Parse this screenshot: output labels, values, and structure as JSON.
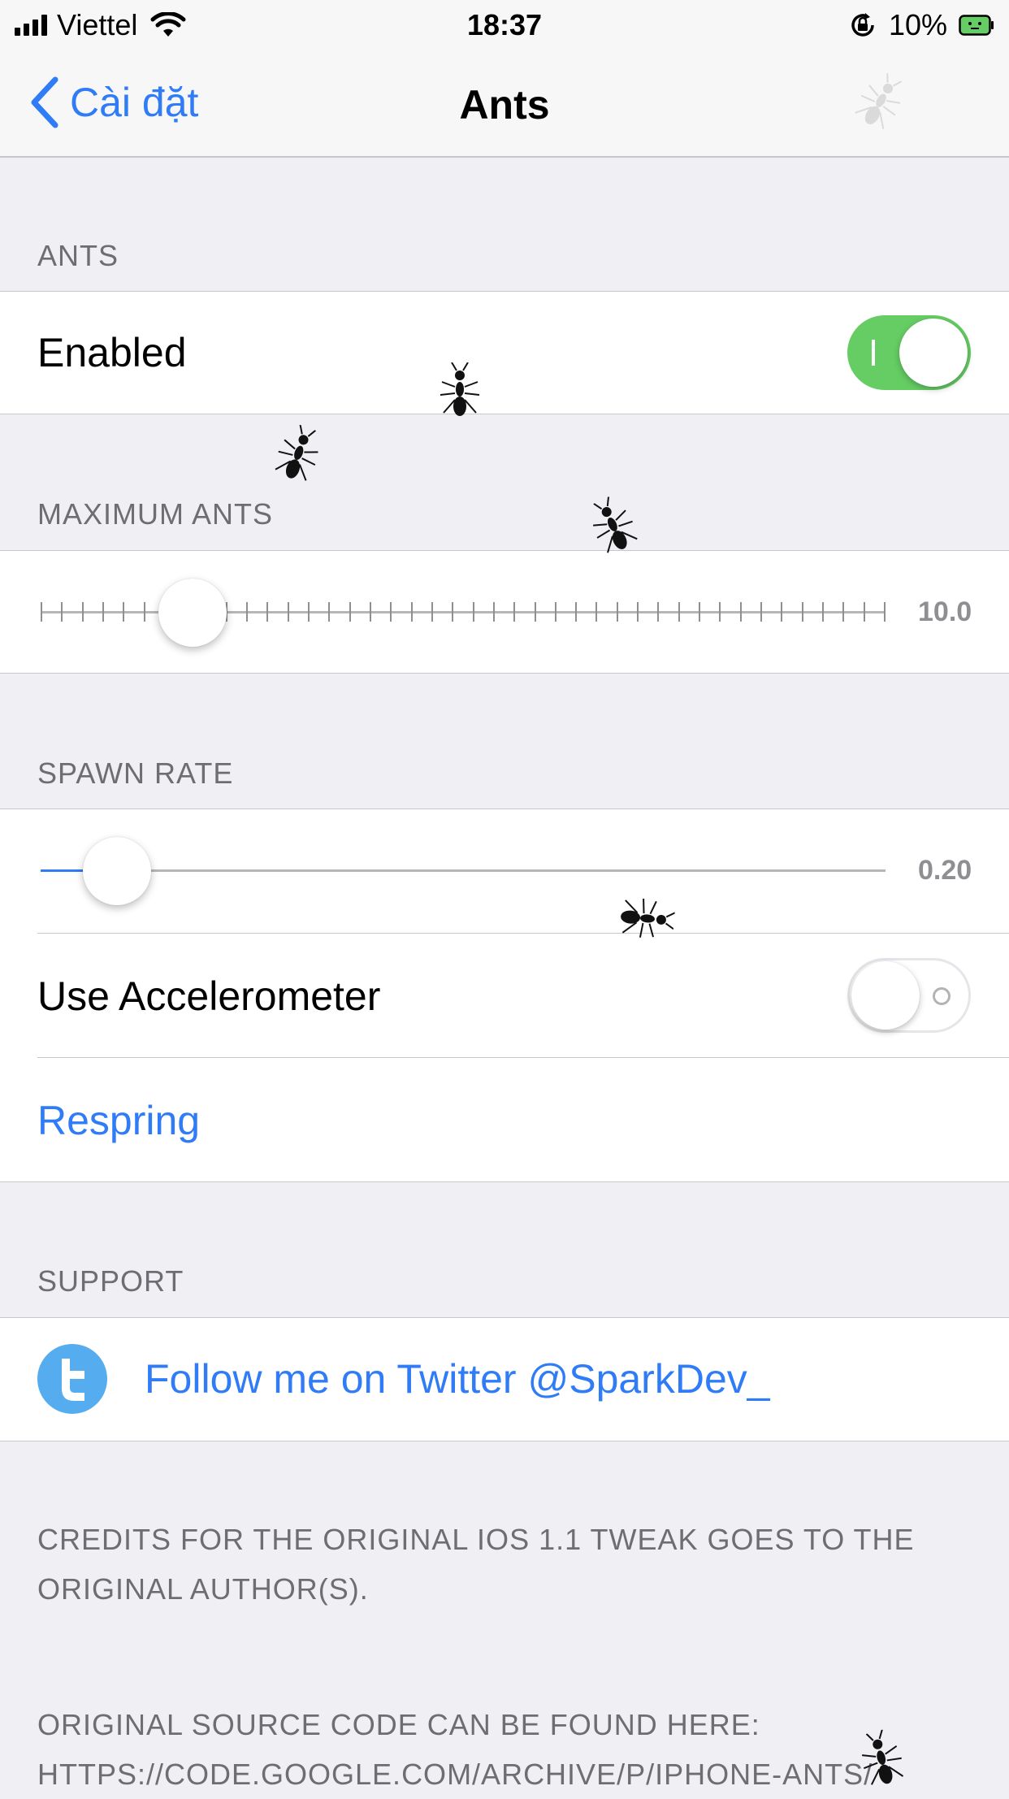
{
  "status_bar": {
    "carrier": "Viettel",
    "time": "18:37",
    "battery_percent": "10%",
    "icons": [
      "signal-bars-icon",
      "wifi-icon",
      "orientation-lock-icon",
      "battery-icon"
    ]
  },
  "nav": {
    "back_label": "Cài đặt",
    "title": "Ants",
    "accent_color": "#2f7cf6"
  },
  "sections": {
    "ants": {
      "header": "ANTS",
      "enabled_label": "Enabled",
      "enabled": true
    },
    "maximum_ants": {
      "header": "MAXIMUM ANTS",
      "value_text": "10.0",
      "value_fraction": 0.18
    },
    "spawn_rate": {
      "header": "SPAWN RATE",
      "value_text": "0.20",
      "value_fraction": 0.09,
      "accelerometer_label": "Use Accelerometer",
      "accelerometer_enabled": false,
      "respring_label": "Respring"
    },
    "support": {
      "header": "SUPPORT",
      "twitter_label": "Follow me on Twitter @SparkDev_",
      "twitter_icon": "twitter-bird-icon"
    }
  },
  "footer": {
    "credits": "CREDITS FOR THE ORIGINAL IOS 1.1 TWEAK GOES TO THE ORIGINAL AUTHOR(S).",
    "source": "ORIGINAL SOURCE CODE CAN BE FOUND HERE: HTTPS://CODE.GOOGLE.COM/ARCHIVE/P/IPHONE-ANTS/"
  },
  "colors": {
    "toggle_on": "#65cd63",
    "background": "#efeff4"
  }
}
